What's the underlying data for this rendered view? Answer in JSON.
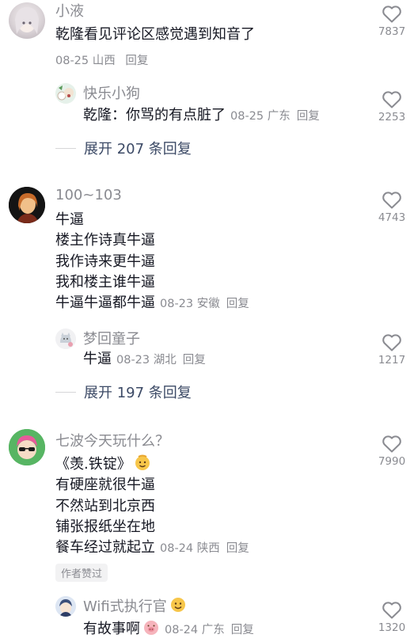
{
  "comments": [
    {
      "username": "小液",
      "text_lines": [
        "乾隆看见评论区感觉遇到知音了"
      ],
      "date": "08-25",
      "location": "山西",
      "reply_label": "回复",
      "likes": "7837",
      "replies": [
        {
          "username": "快乐小狗",
          "text": "乾隆：你骂的有点脏了",
          "date": "08-25",
          "location": "广东",
          "reply_label": "回复",
          "likes": "2253"
        }
      ],
      "expand_label": "展开 207 条回复"
    },
    {
      "username": "100~103",
      "text_lines": [
        "牛逼",
        "楼主作诗真牛逼",
        "我作诗来更牛逼",
        "我和楼主谁牛逼",
        "牛逼牛逼都牛逼"
      ],
      "date": "08-23",
      "location": "安徽",
      "reply_label": "回复",
      "likes": "4743",
      "replies": [
        {
          "username": "梦回童子",
          "text": "牛逼",
          "date": "08-23",
          "location": "湖北",
          "reply_label": "回复",
          "likes": "1217"
        }
      ],
      "expand_label": "展开 197 条回复"
    },
    {
      "username": "七波今天玩什么？",
      "text_lines": [
        "《羡.铁锭》",
        "有硬座就很牛逼",
        "不然站到北京西",
        "铺张报纸坐在地",
        "餐车经过就起立"
      ],
      "date": "08-24",
      "location": "陕西",
      "reply_label": "回复",
      "likes": "7990",
      "author_tag": "作者赞过",
      "replies": [
        {
          "username": "Wifi式执行官",
          "text": "有故事啊",
          "date": "08-24",
          "location": "广东",
          "reply_label": "回复",
          "likes": "1320"
        }
      ]
    }
  ],
  "colors": {
    "text": "#161823",
    "meta": "#8a8b91",
    "expand": "#3c4a66",
    "tag_bg": "#f2f2f3"
  },
  "icons": {
    "like": "heart-outline-icon",
    "emoji": "smiling-face-emoji"
  }
}
